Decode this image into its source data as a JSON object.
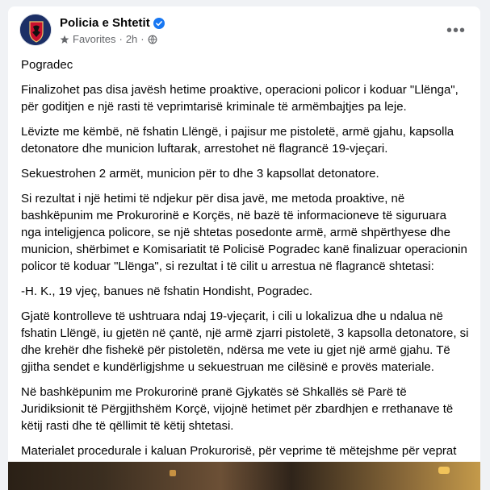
{
  "post": {
    "author": "Policia e Shtetit",
    "audience": "Favorites",
    "time": "2h",
    "paragraphs": [
      "Pogradec",
      "Finalizohet pas disa javësh hetime proaktive, operacioni policor i koduar \"Llënga\", për goditjen e një rasti të veprimtarisë kriminale të armëmbajtjes pa leje.",
      "Lëvizte me këmbë, në fshatin Llëngë, i pajisur me pistoletë, armë gjahu, kapsolla detonatore dhe municion luftarak, arrestohet në flagrancë 19-vjeçari.",
      "Sekuestrohen 2 armët, municion për to dhe 3 kapsollat detonatore.",
      "Si rezultat i një hetimi të ndjekur për disa javë, me metoda proaktive, në bashkëpunim me Prokurorinë e Korçës, në bazë të informacioneve të siguruara nga inteligjenca policore, se një shtetas posedonte armë, armë shpërthyese dhe municion, shërbimet e  Komisariatit të Policisë Pogradec kanë finalizuar operacionin policor të koduar \"Llënga\", si rezultat i të cilit u arrestua në flagrancë shtetasi:",
      "-H. K., 19 vjeç, banues në fshatin Hondisht, Pogradec.",
      "Gjatë kontrolleve të ushtruara ndaj 19-vjeçarit, i cili u lokalizua dhe u ndalua në fshatin Llëngë, iu gjetën në çantë, një armë zjarri pistoletë, 3 kapsolla detonatore, si dhe krehër dhe fishekë për pistoletën, ndërsa me vete iu gjet një armë gjahu. Të gjitha sendet e kundërligjshme u sekuestruan me cilësinë e provës materiale.",
      "Në bashkëpunim me Prokurorinë pranë Gjykatës së Shkallës së Parë të Juridiksionit të Përgjithshëm Korçë, vijojnë hetimet për zbardhjen e rrethanave të këtij rasti dhe të qëllimit të këtij shtetasi.",
      "Materialet procedurale i kaluan Prokurorisë, për veprime të mëtejshme për veprat penale \"Mbajtja pa leje dhe prodhimi i armëve, armëve shpërthyese dhe i municionit\" dhe \"Prodhimi dhe mbajtja pa leje e armëve të gjuetisë dhe sportive\"."
    ]
  },
  "icons": {
    "verified": "verified-badge-icon",
    "audience": "star-icon",
    "privacy": "globe-icon",
    "more": "more-options-icon"
  },
  "colors": {
    "verified": "#1877f2",
    "secondary_text": "#65676b"
  }
}
